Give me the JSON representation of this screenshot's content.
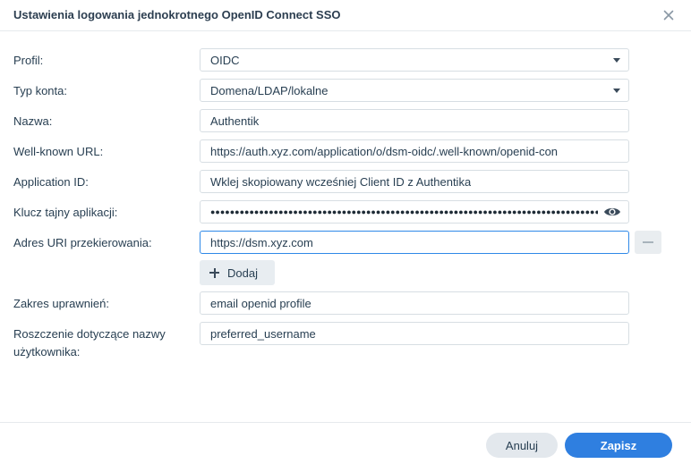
{
  "dialog": {
    "title": "Ustawienia logowania jednokrotnego OpenID Connect SSO"
  },
  "form": {
    "profile": {
      "label": "Profil:",
      "value": "OIDC"
    },
    "account_type": {
      "label": "Typ konta:",
      "value": "Domena/LDAP/lokalne"
    },
    "name": {
      "label": "Nazwa:",
      "value": "Authentik"
    },
    "well_known_url": {
      "label": "Well-known URL:",
      "value": "https://auth.xyz.com/application/o/dsm-oidc/.well-known/openid-con"
    },
    "application_id": {
      "label": "Application ID:",
      "value": "Wklej skopiowany wcześniej Client ID z Authentika"
    },
    "secret": {
      "label": "Klucz tajny aplikacji:",
      "value": "●●●●●●●●●●●●●●●●●●●●●●●●●●●●●●●●●●●●●●●●●●●●●●●●●●●●●●●●●●●●●●●●●●●●●●●●●●●●●●●●"
    },
    "redirect_uri": {
      "label": "Adres URI przekierowania:",
      "value": "https://dsm.xyz.com"
    },
    "add_button": "Dodaj",
    "scope": {
      "label": "Zakres uprawnień:",
      "value": "email openid profile"
    },
    "username_claim": {
      "label_line1": "Roszczenie dotyczące nazwy",
      "label_line2": "użytkownika:",
      "value": "preferred_username"
    }
  },
  "footer": {
    "cancel_label": "Anuluj",
    "save_label": "Zapisz"
  },
  "colors": {
    "accent": "#2f7fe0",
    "focus_border": "#2f89e8"
  },
  "icons": [
    "close-icon",
    "chevron-down-icon",
    "eye-icon",
    "minus-icon",
    "plus-icon"
  ]
}
